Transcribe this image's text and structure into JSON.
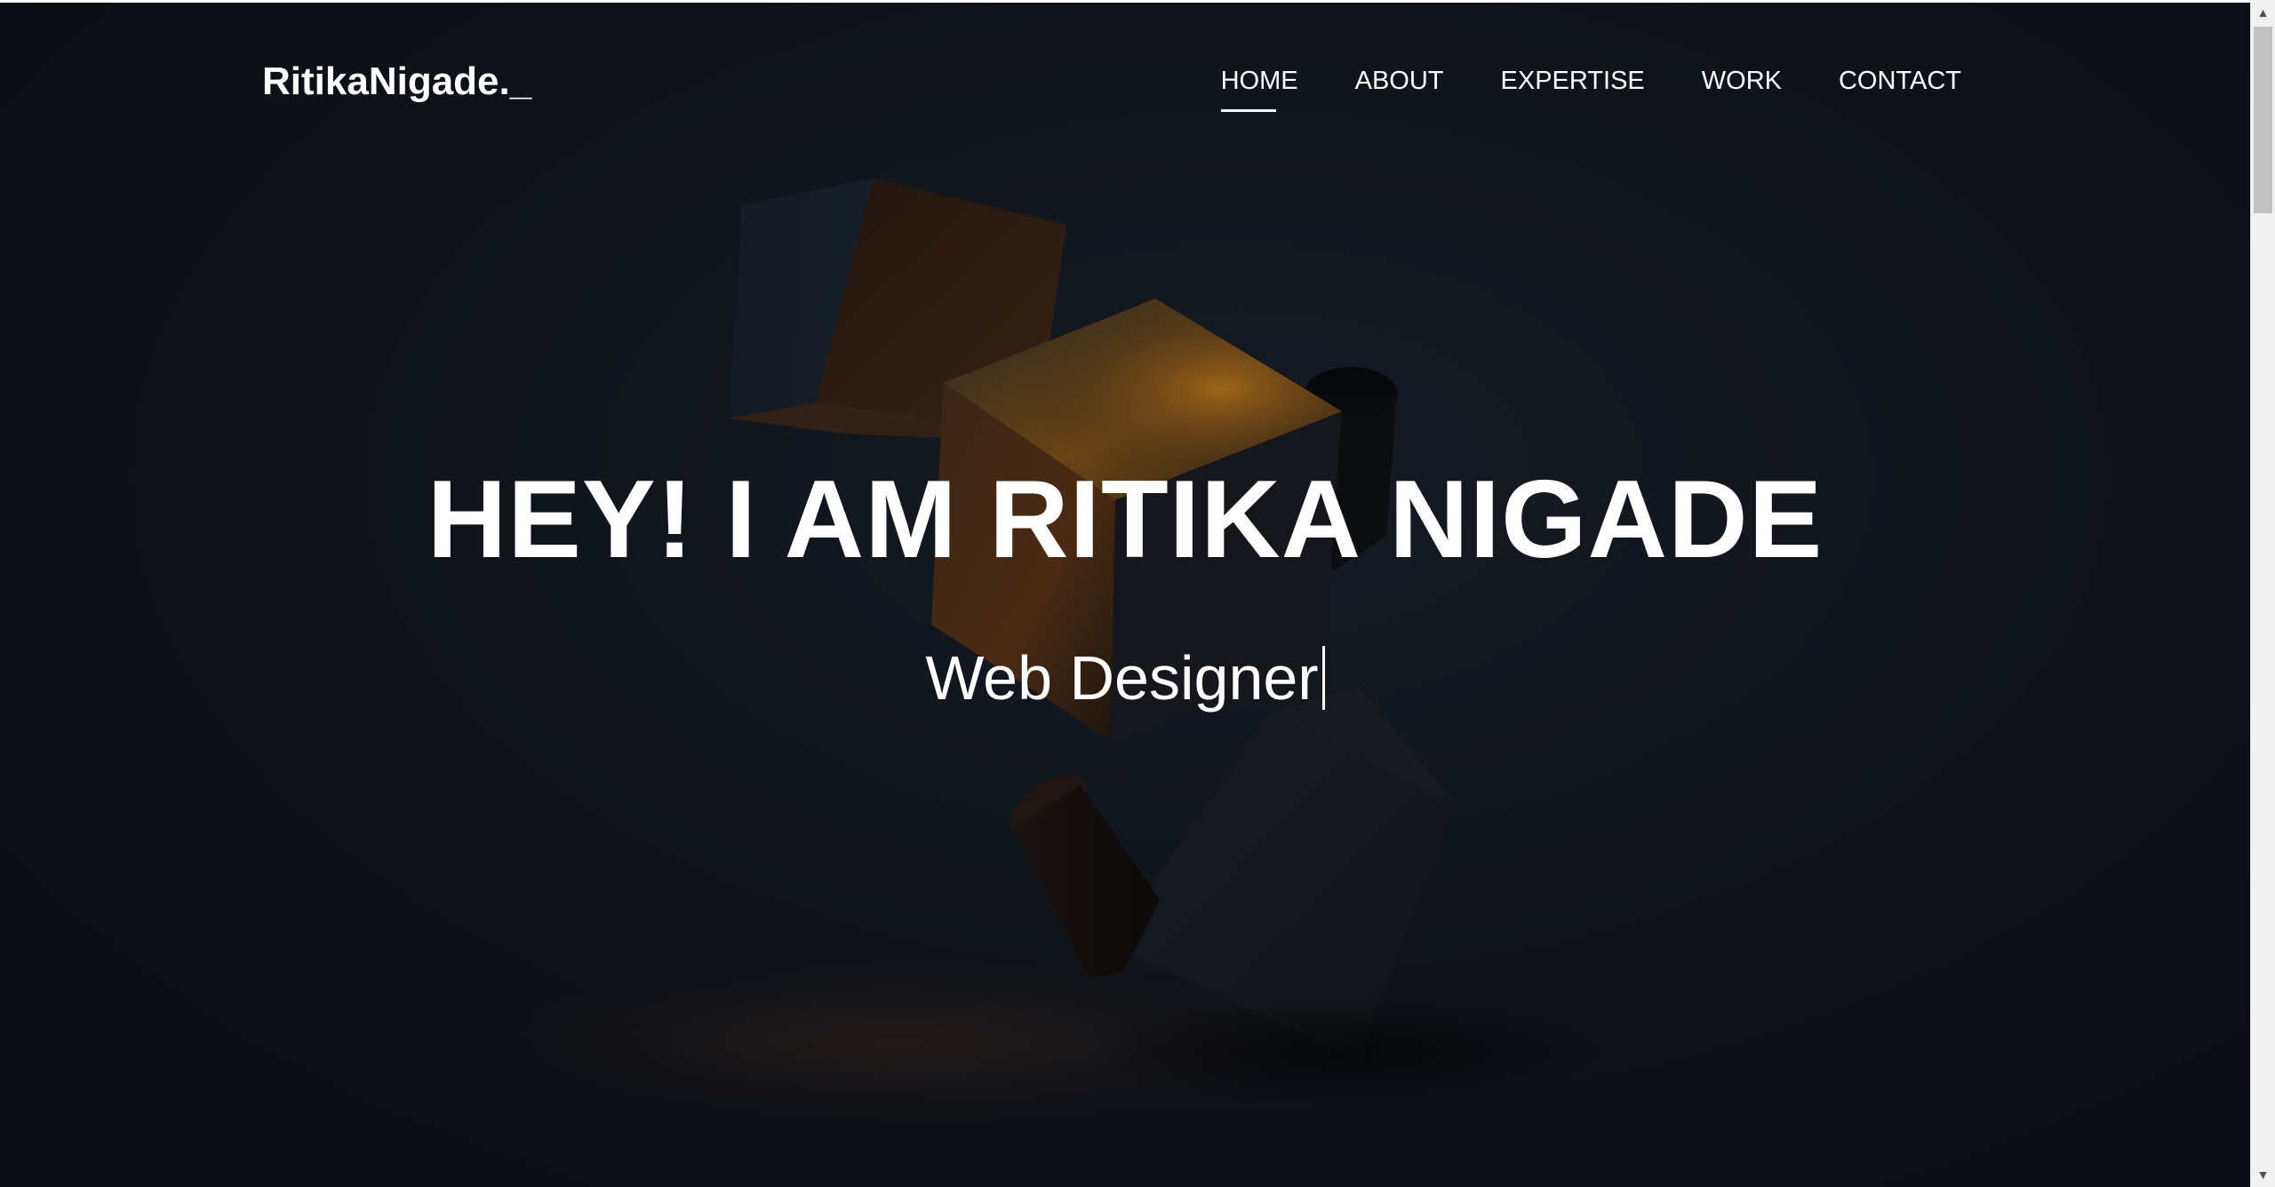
{
  "header": {
    "logo": "RitikaNigade._"
  },
  "nav": {
    "items": [
      {
        "label": "HOME",
        "active": true
      },
      {
        "label": "ABOUT",
        "active": false
      },
      {
        "label": "EXPERTISE",
        "active": false
      },
      {
        "label": "WORK",
        "active": false
      },
      {
        "label": "CONTACT",
        "active": false
      }
    ]
  },
  "hero": {
    "title": "HEY! I AM RITIKA NIGADE",
    "subtitle": "Web Designer"
  },
  "colors": {
    "background": "#10141b",
    "text": "#ffffff",
    "accent_glow": "#c8741c"
  },
  "scrollbar": {
    "up_icon": "triangle-up-icon",
    "down_icon": "triangle-down-icon"
  }
}
